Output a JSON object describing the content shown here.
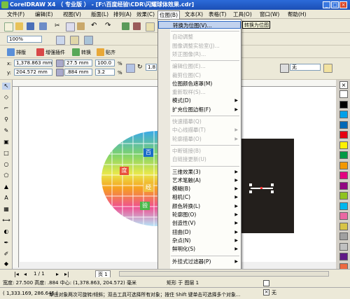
{
  "window": {
    "title": "CorelDRAW X4 （ 专业版 ） - [F:\\百度经验\\CDR\\闪耀球体效果.cdr]",
    "min": "_",
    "max": "□",
    "close": "×"
  },
  "menubar": [
    {
      "label": "文件(F)"
    },
    {
      "label": "编辑(E)"
    },
    {
      "label": "视图(V)"
    },
    {
      "label": "版面(L)"
    },
    {
      "label": "排列(A)"
    },
    {
      "label": "效果(C)"
    },
    {
      "label": "位图(B)"
    },
    {
      "label": "文本(X)"
    },
    {
      "label": "表格(T)"
    },
    {
      "label": "工具(O)"
    },
    {
      "label": "窗口(W)"
    },
    {
      "label": "帮助(H)"
    }
  ],
  "toolbar": {
    "zoom": "100%",
    "plugin_tabs": [
      "排版",
      "增强插件",
      "转换",
      "贴齐"
    ],
    "x_label": "x:",
    "x_value": "1,378.863 mm",
    "y_label": "y:",
    "y_value": "204.572 mm",
    "w_value": "27.5 mm",
    "h_value": ".884 mm",
    "sx_value": "100.0",
    "sy_value": "3.2",
    "pct": "%",
    "rot_value": "1.8",
    "outline_value": "无",
    "tooltip": "转换为位图"
  },
  "bitmap_menu": {
    "items": [
      {
        "label": "转换为位图(V)...",
        "enabled": true,
        "highlight": true
      },
      {
        "sep": true
      },
      {
        "label": "自动调整",
        "enabled": false
      },
      {
        "label": "图像调整实验室(J)...",
        "enabled": false
      },
      {
        "label": "矫正图像(R)...",
        "enabled": false
      },
      {
        "sep": true
      },
      {
        "label": "编辑位图(E)...",
        "enabled": false
      },
      {
        "label": "裁剪位图(C)",
        "enabled": false
      },
      {
        "label": "位图颜色遮罩(M)",
        "enabled": true
      },
      {
        "label": "重新取样(S)...",
        "enabled": false
      },
      {
        "label": "模式(D)",
        "enabled": true,
        "sub": true
      },
      {
        "label": "扩充位图边框(F)",
        "enabled": true,
        "sub": true
      },
      {
        "sep": true
      },
      {
        "label": "快速描摹(Q)",
        "enabled": false
      },
      {
        "label": "中心线描摹(T)",
        "enabled": false,
        "sub": true
      },
      {
        "label": "轮廓描摹(O)",
        "enabled": false,
        "sub": true
      },
      {
        "sep": true
      },
      {
        "label": "中断链接(B)",
        "enabled": false
      },
      {
        "label": "自链接更新(U)",
        "enabled": false
      },
      {
        "sep": true
      },
      {
        "label": "三维效果(3)",
        "enabled": true,
        "sub": true
      },
      {
        "label": "艺术笔触(A)",
        "enabled": true,
        "sub": true
      },
      {
        "label": "模糊(B)",
        "enabled": true,
        "sub": true
      },
      {
        "label": "相机(C)",
        "enabled": true,
        "sub": true
      },
      {
        "label": "颜色转换(L)",
        "enabled": true,
        "sub": true
      },
      {
        "label": "轮廓图(O)",
        "enabled": true,
        "sub": true
      },
      {
        "label": "创造性(V)",
        "enabled": true,
        "sub": true
      },
      {
        "label": "扭曲(D)",
        "enabled": true,
        "sub": true
      },
      {
        "label": "杂点(N)",
        "enabled": true,
        "sub": true
      },
      {
        "label": "鲜明化(S)",
        "enabled": true,
        "sub": true
      },
      {
        "sep": true
      },
      {
        "label": "外挂式过滤器(P)",
        "enabled": true,
        "sub": true
      }
    ]
  },
  "sphere_labels": [
    "百",
    "度",
    "经",
    "验"
  ],
  "pager": {
    "nav": "1 / 1",
    "tab": "页 1"
  },
  "status": {
    "line1": "宽度: 27.500 高度: .884  中心: (1,378.863, 204.572) 毫米",
    "line2": "单击对象两次可旋转/倾斜；双击工具可选择所有对象；按住 Shift 键单击可选择多个对象...",
    "coords": "( 1,333.169, 286.645 )",
    "obj_info": "矩形 于 图层 1",
    "fill_none": "无"
  },
  "palette": [
    "#ffffff",
    "#000000",
    "#00a0e9",
    "#0068b7",
    "#e60012",
    "#fff100",
    "#009944",
    "#f39800",
    "#e4007f",
    "#920783",
    "#8fc31f",
    "#00b7ee",
    "#ea68a2",
    "#d7c447",
    "#a0a0a0",
    "#c0c0c0",
    "#601986",
    "#ec6941"
  ],
  "colors": {
    "title": "#1b4fb5",
    "highlight": "#c1d2ee"
  }
}
